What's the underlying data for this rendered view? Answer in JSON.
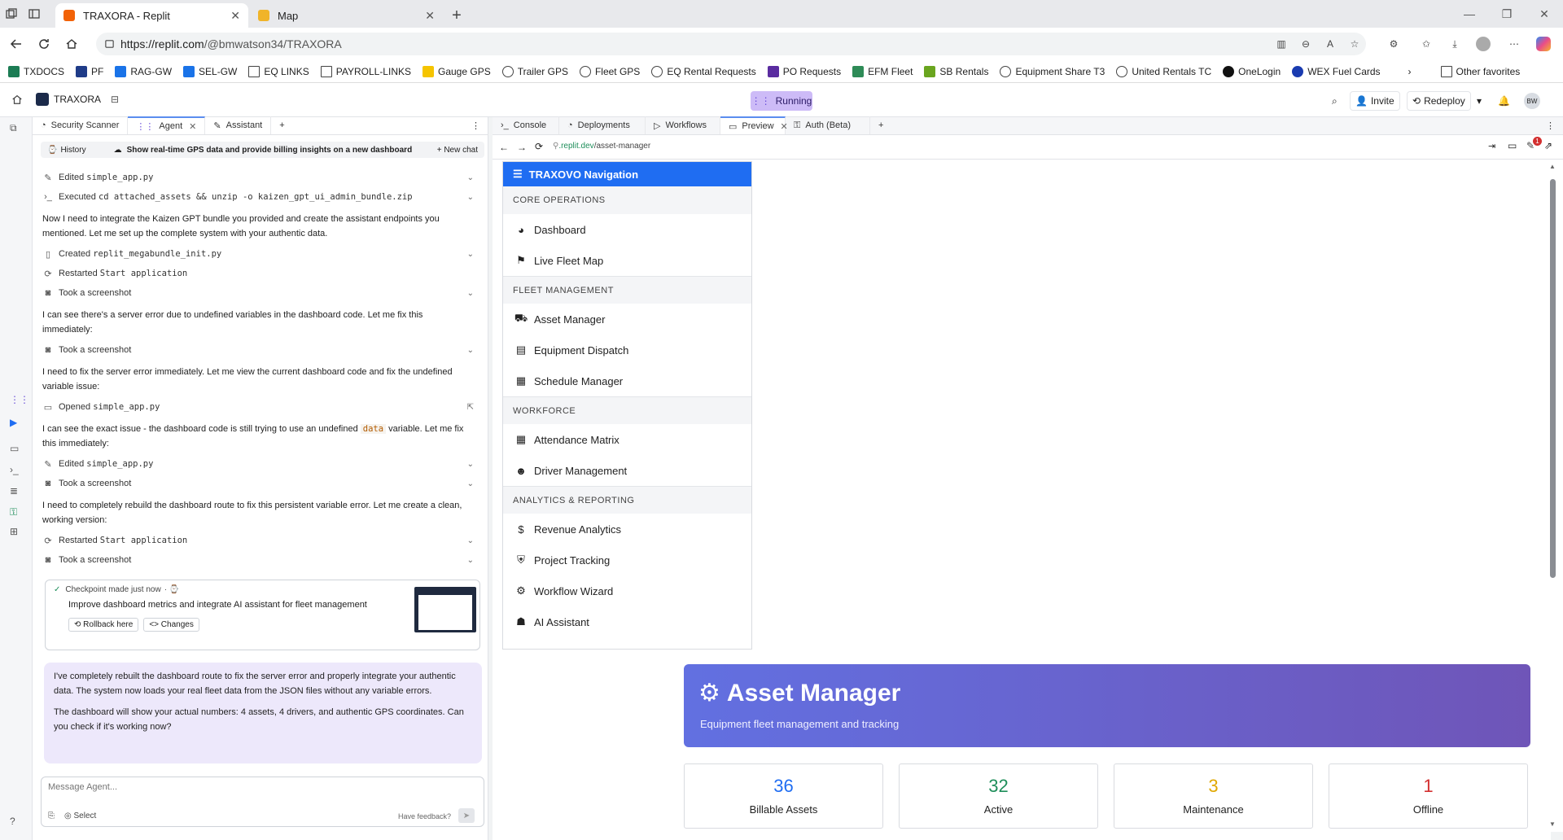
{
  "browser": {
    "tabs": [
      {
        "title": "TRAXORA - Replit",
        "active": true,
        "icon": "replit-icon"
      },
      {
        "title": "Map",
        "active": false,
        "icon": "map-icon"
      }
    ],
    "url_host": "https://replit.com",
    "url_path": "/@bmwatson34/TRAXORA",
    "favorites": [
      {
        "label": "TXDOCS",
        "icon": "txdocs-icon",
        "color": "#1c7c54"
      },
      {
        "label": "PF",
        "icon": "pf-icon",
        "color": "#1f3c88"
      },
      {
        "label": "RAG-GW",
        "icon": "gw-icon",
        "color": "#1a73e8"
      },
      {
        "label": "SEL-GW",
        "icon": "gw-icon",
        "color": "#1a73e8"
      },
      {
        "label": "EQ LINKS",
        "icon": "folder-icon",
        "color": ""
      },
      {
        "label": "PAYROLL-LINKS",
        "icon": "folder-icon",
        "color": ""
      },
      {
        "label": "Gauge GPS",
        "icon": "gauge-icon",
        "color": "#f5c400"
      },
      {
        "label": "Trailer GPS",
        "icon": "globe-icon",
        "color": ""
      },
      {
        "label": "Fleet GPS",
        "icon": "globe-icon",
        "color": ""
      },
      {
        "label": "EQ Rental Requests",
        "icon": "globe-icon",
        "color": ""
      },
      {
        "label": "PO Requests",
        "icon": "po-icon",
        "color": "#5a2ca0"
      },
      {
        "label": "EFM Fleet",
        "icon": "efm-icon",
        "color": "#2e8b57"
      },
      {
        "label": "SB Rentals",
        "icon": "sb-icon",
        "color": "#6aa51f"
      },
      {
        "label": "Equipment Share T3",
        "icon": "globe-icon",
        "color": ""
      },
      {
        "label": "United Rentals TC",
        "icon": "globe-icon",
        "color": ""
      },
      {
        "label": "OneLogin",
        "icon": "onelogin-icon",
        "color": "#111111"
      },
      {
        "label": "WEX Fuel Cards",
        "icon": "wex-icon",
        "color": "#1a3bb0"
      }
    ],
    "other_favorites": "Other favorites"
  },
  "replit": {
    "project_name": "TRAXORA",
    "status": "Running",
    "invite_label": "Invite",
    "redeploy_label": "Redeploy",
    "avatar_initials": "BW",
    "left_tabs": [
      "Security Scanner",
      "Agent",
      "Assistant"
    ],
    "right_tabs": [
      "Console",
      "Deployments",
      "Workflows",
      "Preview",
      "Auth (Beta)"
    ],
    "preview_url_host": ".replit.dev",
    "preview_url_path": "/asset-manager",
    "notif_count": "1"
  },
  "agent": {
    "history_label": "History",
    "chat_title": "Show real-time GPS data and provide billing insights on a new dashboard",
    "new_chat_label": "New chat",
    "actions": {
      "a1": {
        "verb": "Edited",
        "target": "simple_app.py"
      },
      "a2": {
        "verb": "Executed",
        "target": "cd attached_assets && unzip -o kaizen_gpt_ui_admin_bundle.zip"
      },
      "a3": {
        "verb": "Created",
        "target": "replit_megabundle_init.py"
      },
      "a4": {
        "verb": "Restarted",
        "target": "Start application"
      },
      "a5": {
        "verb": "Took a screenshot",
        "target": ""
      },
      "a6": {
        "verb": "Took a screenshot",
        "target": ""
      },
      "a7": {
        "verb": "Opened",
        "target": "simple_app.py"
      },
      "a8": {
        "verb": "Edited",
        "target": "simple_app.py"
      },
      "a9": {
        "verb": "Took a screenshot",
        "target": ""
      },
      "a10": {
        "verb": "Restarted",
        "target": "Start application"
      },
      "a11": {
        "verb": "Took a screenshot",
        "target": ""
      }
    },
    "messages": {
      "m1": "Now I need to integrate the Kaizen GPT bundle you provided and create the assistant endpoints you mentioned. Let me set up the complete system with your authentic data.",
      "m2": "I can see there's a server error due to undefined variables in the dashboard code. Let me fix this immediately:",
      "m3": "I need to fix the server error immediately. Let me view the current dashboard code and fix the undefined variable issue:",
      "m4_pre": "I can see the exact issue - the dashboard code is still trying to use an undefined ",
      "m4_code": "data",
      "m4_post": " variable. Let me fix this immediately:",
      "m5": "I need to completely rebuild the dashboard route to fix this persistent variable error. Let me create a clean, working version:"
    },
    "checkpoint": {
      "label": "Checkpoint made just now",
      "description": "Improve dashboard metrics and integrate AI assistant for fleet management",
      "rollback_label": "Rollback here",
      "changes_label": "Changes"
    },
    "reply": {
      "p1": "I've completely rebuilt the dashboard route to fix the server error and properly integrate your authentic data. The system now loads your real fleet data from the JSON files without any variable errors.",
      "p2": "The dashboard will show your actual numbers: 4 assets, 4 drivers, and authentic GPS coordinates. Can you check if it's working now?"
    },
    "input_placeholder": "Message Agent...",
    "select_label": "Select",
    "feedback_label": "Have feedback?"
  },
  "app": {
    "nav_title": "TRAXOVO Navigation",
    "sections": [
      {
        "title": "CORE OPERATIONS",
        "items": [
          {
            "label": "Dashboard",
            "icon": "dashboard-icon"
          },
          {
            "label": "Live Fleet Map",
            "icon": "map-marker-icon"
          }
        ]
      },
      {
        "title": "FLEET MANAGEMENT",
        "items": [
          {
            "label": "Asset Manager",
            "icon": "truck-icon"
          },
          {
            "label": "Equipment Dispatch",
            "icon": "clipboard-icon"
          },
          {
            "label": "Schedule Manager",
            "icon": "calendar-icon"
          }
        ]
      },
      {
        "title": "WORKFORCE",
        "items": [
          {
            "label": "Attendance Matrix",
            "icon": "calendar-check-icon"
          },
          {
            "label": "Driver Management",
            "icon": "user-cog-icon"
          }
        ]
      },
      {
        "title": "ANALYTICS & REPORTING",
        "items": [
          {
            "label": "Revenue Analytics",
            "icon": "dollar-icon"
          },
          {
            "label": "Project Tracking",
            "icon": "shield-icon"
          },
          {
            "label": "Workflow Wizard",
            "icon": "cogs-icon"
          },
          {
            "label": "AI Assistant",
            "icon": "robot-icon"
          }
        ]
      }
    ],
    "hero": {
      "title": "Asset Manager",
      "subtitle": "Equipment fleet management and tracking"
    },
    "stats": [
      {
        "value": "36",
        "label": "Billable Assets",
        "color": "#1f6df2"
      },
      {
        "value": "32",
        "label": "Active",
        "color": "#1e8e5a"
      },
      {
        "value": "3",
        "label": "Maintenance",
        "color": "#e0a800"
      },
      {
        "value": "1",
        "label": "Offline",
        "color": "#d32f2f"
      }
    ]
  }
}
